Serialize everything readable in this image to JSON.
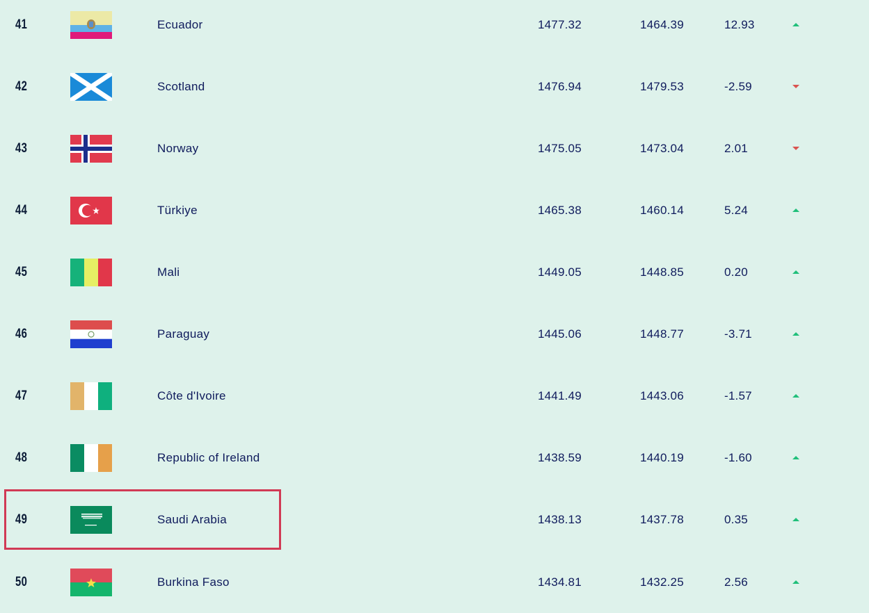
{
  "rows": [
    {
      "rank": "41",
      "name": "Ecuador",
      "flag": "ecuador-flag-icon",
      "total": "1477.32",
      "previous": "1464.39",
      "diff": "12.93",
      "trend": "up"
    },
    {
      "rank": "42",
      "name": "Scotland",
      "flag": "scotland-flag-icon",
      "total": "1476.94",
      "previous": "1479.53",
      "diff": "-2.59",
      "trend": "down"
    },
    {
      "rank": "43",
      "name": "Norway",
      "flag": "norway-flag-icon",
      "total": "1475.05",
      "previous": "1473.04",
      "diff": "2.01",
      "trend": "down"
    },
    {
      "rank": "44",
      "name": "Türkiye",
      "flag": "turkiye-flag-icon",
      "total": "1465.38",
      "previous": "1460.14",
      "diff": "5.24",
      "trend": "up"
    },
    {
      "rank": "45",
      "name": "Mali",
      "flag": "mali-flag-icon",
      "total": "1449.05",
      "previous": "1448.85",
      "diff": "0.20",
      "trend": "up"
    },
    {
      "rank": "46",
      "name": "Paraguay",
      "flag": "paraguay-flag-icon",
      "total": "1445.06",
      "previous": "1448.77",
      "diff": "-3.71",
      "trend": "up"
    },
    {
      "rank": "47",
      "name": "Côte d'Ivoire",
      "flag": "cote-divoire-flag-icon",
      "total": "1441.49",
      "previous": "1443.06",
      "diff": "-1.57",
      "trend": "up"
    },
    {
      "rank": "48",
      "name": "Republic of Ireland",
      "flag": "ireland-flag-icon",
      "total": "1438.59",
      "previous": "1440.19",
      "diff": "-1.60",
      "trend": "up"
    },
    {
      "rank": "49",
      "name": "Saudi Arabia",
      "flag": "saudi-arabia-flag-icon",
      "total": "1438.13",
      "previous": "1437.78",
      "diff": "0.35",
      "trend": "up",
      "highlighted": true
    },
    {
      "rank": "50",
      "name": "Burkina Faso",
      "flag": "burkina-faso-flag-icon",
      "total": "1434.81",
      "previous": "1432.25",
      "diff": "2.56",
      "trend": "up"
    }
  ],
  "colors": {
    "background": "#def2eb",
    "text": "#0f1b5c",
    "trend_up": "#1fbf7a",
    "trend_down": "#d9534f",
    "highlight_border": "#d13a55"
  }
}
